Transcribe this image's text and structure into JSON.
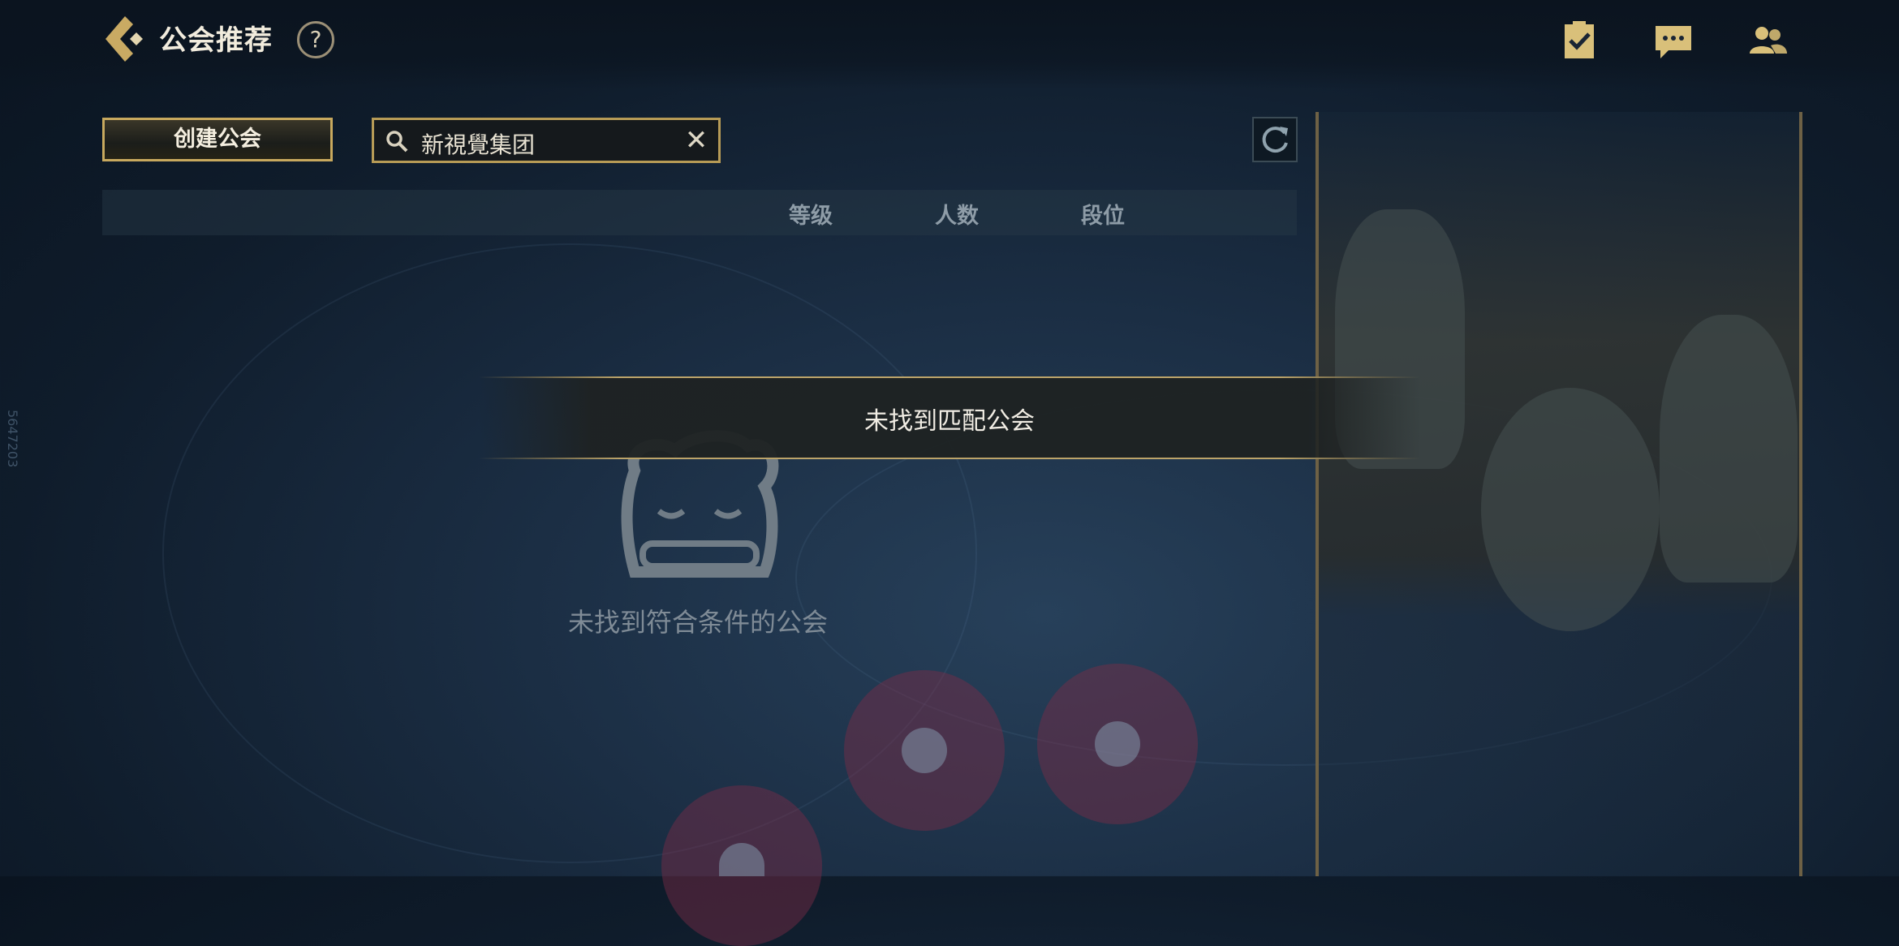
{
  "header": {
    "title": "公会推荐",
    "help_label": "?"
  },
  "toolbar": {
    "create_label": "创建公会",
    "search_value": "新視覺集团",
    "clear_label": "✕"
  },
  "table": {
    "columns": [
      "等级",
      "人数",
      "段位"
    ]
  },
  "empty_state": {
    "message": "未找到符合条件的公会"
  },
  "toast": {
    "message": "未找到匹配公会"
  },
  "side_id": "5647203",
  "icons": {
    "back": "back-chevron-icon",
    "help": "question-icon",
    "missions": "clipboard-check-icon",
    "chat": "chat-bubble-icon",
    "friends": "friends-icon",
    "search": "search-icon",
    "refresh": "refresh-icon",
    "empty": "sleeping-poro-icon"
  },
  "colors": {
    "gold": "#c8a95e",
    "background": "#14243a",
    "text": "#f2ecdd"
  }
}
